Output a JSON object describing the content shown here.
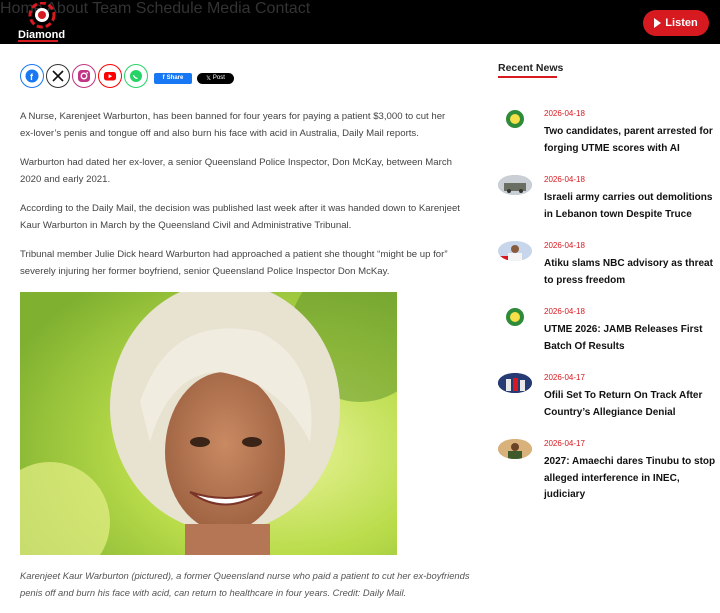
{
  "brand": {
    "name": "Diamond",
    "accent": "#d71920"
  },
  "nav": {
    "items": [
      "Home",
      "About",
      "Team",
      "Schedule",
      "Media",
      "Contact"
    ]
  },
  "listen_button": {
    "label": "Listen"
  },
  "share": {
    "icons": [
      "facebook-icon",
      "x-icon",
      "instagram-icon",
      "youtube-icon",
      "whatsapp-icon"
    ],
    "fb_label": "Share",
    "x_label": "Post"
  },
  "article": {
    "paragraphs": [
      "A Nurse, Karenjeet Warburton, has been banned for four years for paying a patient $3,000 to cut her ex-lover’s penis and tongue off and also burn his face with acid in Australia, Daily Mail reports.",
      "Warburton had dated her ex-lover, a senior Queensland Police Inspector, Don McKay, between March 2020 and early 2021.",
      "According to the Daily Mail, the decision was published last week after it was handed down to Karenjeet Kaur Warburton in March by the Queensland Civil and Administrative Tribunal.",
      "Tribunal member Julie Dick heard Warburton had approached a patient she thought “might be up for” severely injuring her former boyfriend, senior Queensland Police Inspector Don McKay."
    ],
    "caption": "Karenjeet Kaur Warburton (pictured), a former Queensland nurse who paid a patient to cut her ex-boyfriends penis off and burn his face with acid, can return to healthcare in four years. Credit: Daily Mail."
  },
  "sidebar": {
    "title": "Recent News",
    "items": [
      {
        "date": "2026-04-18",
        "title": "Two candidates, parent arrested for forging UTME scores with AI",
        "thumb": "jamb-logo"
      },
      {
        "date": "2026-04-18",
        "title": "Israeli army carries out demolitions in Lebanon town Despite Truce",
        "thumb": "vehicle-photo"
      },
      {
        "date": "2026-04-18",
        "title": "Atiku slams NBC advisory as threat to press freedom",
        "thumb": "person-photo"
      },
      {
        "date": "2026-04-18",
        "title": "UTME 2026: JAMB Releases First Batch Of Results",
        "thumb": "jamb-logo"
      },
      {
        "date": "2026-04-17",
        "title": "Ofili Set To Return On Track After Country’s Allegiance Denial",
        "thumb": "athletes-photo"
      },
      {
        "date": "2026-04-17",
        "title": "2027: Amaechi dares Tinubu to stop alleged interference in INEC, judiciary",
        "thumb": "person-photo"
      }
    ]
  }
}
